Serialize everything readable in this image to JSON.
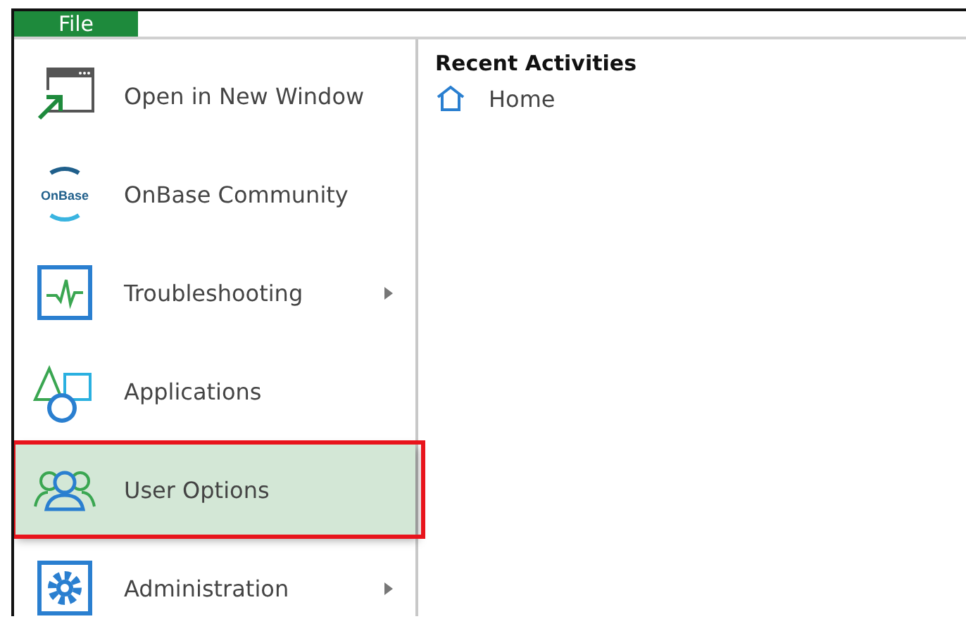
{
  "file_tab": {
    "label": "File",
    "selected": true
  },
  "menu": [
    {
      "label": "Open in New Window",
      "submenu": false,
      "selected": false
    },
    {
      "label": "OnBase Community",
      "submenu": false,
      "selected": false,
      "logo_text": "OnBase"
    },
    {
      "label": "Troubleshooting",
      "submenu": true,
      "selected": false
    },
    {
      "label": "Applications",
      "submenu": false,
      "selected": false
    },
    {
      "label": "User Options",
      "submenu": false,
      "selected": true,
      "annotated": true
    },
    {
      "label": "Administration",
      "submenu": true,
      "selected": false
    }
  ],
  "recent": {
    "title": "Recent Activities",
    "items": [
      {
        "label": "Home"
      }
    ]
  }
}
